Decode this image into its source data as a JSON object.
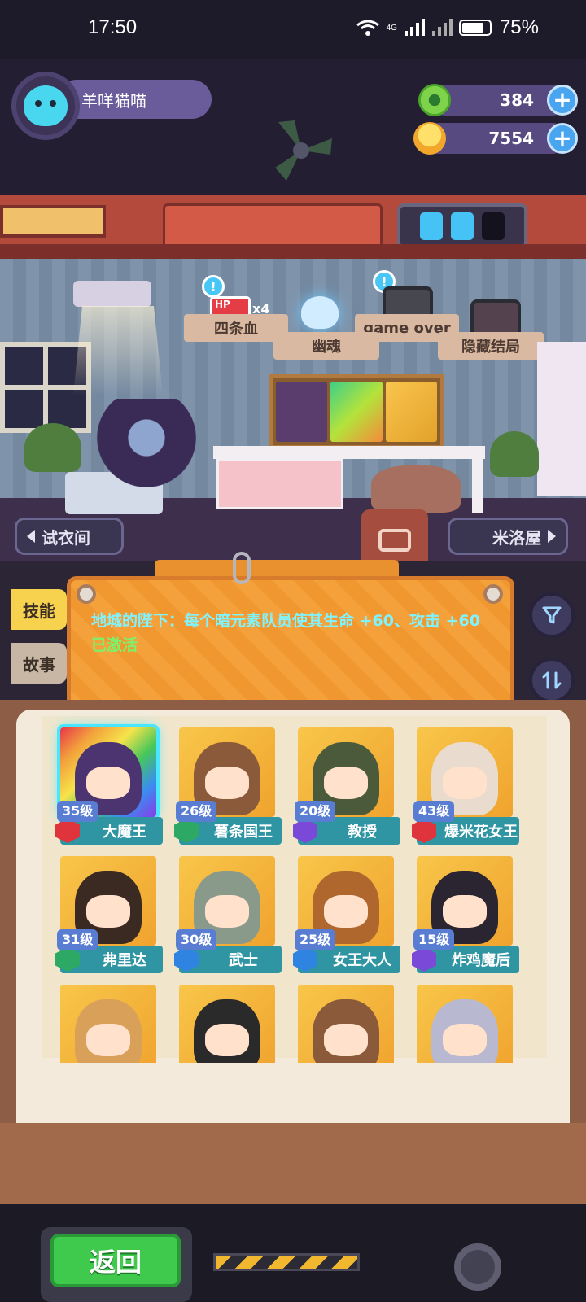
{
  "status_bar": {
    "time": "17:50",
    "battery": "75%",
    "signal_label": "4G"
  },
  "player": {
    "name": "羊咩猫喵"
  },
  "currency": {
    "gems": "384",
    "coins": "7554"
  },
  "room": {
    "endings": [
      {
        "label": "四条血",
        "badge": "HP",
        "multiplier": "x4"
      },
      {
        "label": "幽魂"
      },
      {
        "label": "game over"
      },
      {
        "label": "隐藏结局"
      }
    ],
    "energy_cells": [
      true,
      true,
      false
    ]
  },
  "nav": {
    "left_label": "试衣间",
    "right_label": "米洛屋"
  },
  "tabs": {
    "skill": "技能",
    "story": "故事"
  },
  "skill_board": {
    "text": "地城的陛下：每个暗元素队员使其生命 +60、攻击 +60",
    "status": "已激活"
  },
  "heroes": [
    {
      "level": "35级",
      "name": "大魔王",
      "badge": "red",
      "selected": true,
      "color": "#4b3470",
      "bg": "rainbow"
    },
    {
      "level": "26级",
      "name": "薯条国王",
      "badge": "green",
      "selected": false,
      "color": "#8a5a3a",
      "bg": "gold"
    },
    {
      "level": "20级",
      "name": "教授",
      "badge": "purple",
      "selected": false,
      "color": "#4a5a3a",
      "bg": "gold"
    },
    {
      "level": "43级",
      "name": "爆米花女王",
      "badge": "red",
      "selected": false,
      "color": "#e9dccf",
      "bg": "gold"
    },
    {
      "level": "31级",
      "name": "弗里达",
      "badge": "green",
      "selected": false,
      "color": "#3a2a22",
      "bg": "gold"
    },
    {
      "level": "30级",
      "name": "武士",
      "badge": "blue",
      "selected": false,
      "color": "#8a9a8a",
      "bg": "gold"
    },
    {
      "level": "25级",
      "name": "女王大人",
      "badge": "blue",
      "selected": false,
      "color": "#b0672e",
      "bg": "gold"
    },
    {
      "level": "15级",
      "name": "炸鸡魔后",
      "badge": "purple",
      "selected": false,
      "color": "#2a2530",
      "bg": "gold"
    },
    {
      "level": "",
      "name": "",
      "badge": "",
      "selected": false,
      "color": "#d9a05a",
      "bg": "gold"
    },
    {
      "level": "",
      "name": "",
      "badge": "",
      "selected": false,
      "color": "#2a2a2a",
      "bg": "gold"
    },
    {
      "level": "",
      "name": "",
      "badge": "",
      "selected": false,
      "color": "#8a5a3a",
      "bg": "gold"
    },
    {
      "level": "",
      "name": "",
      "badge": "",
      "selected": false,
      "color": "#b8b8d0",
      "bg": "gold"
    }
  ],
  "footer": {
    "back_label": "返回"
  },
  "colors": {
    "accent_cyan": "#49e7ff",
    "skill_text": "#7ff4ff",
    "active_green": "#7cf26b",
    "back_button": "#3fca4e"
  }
}
